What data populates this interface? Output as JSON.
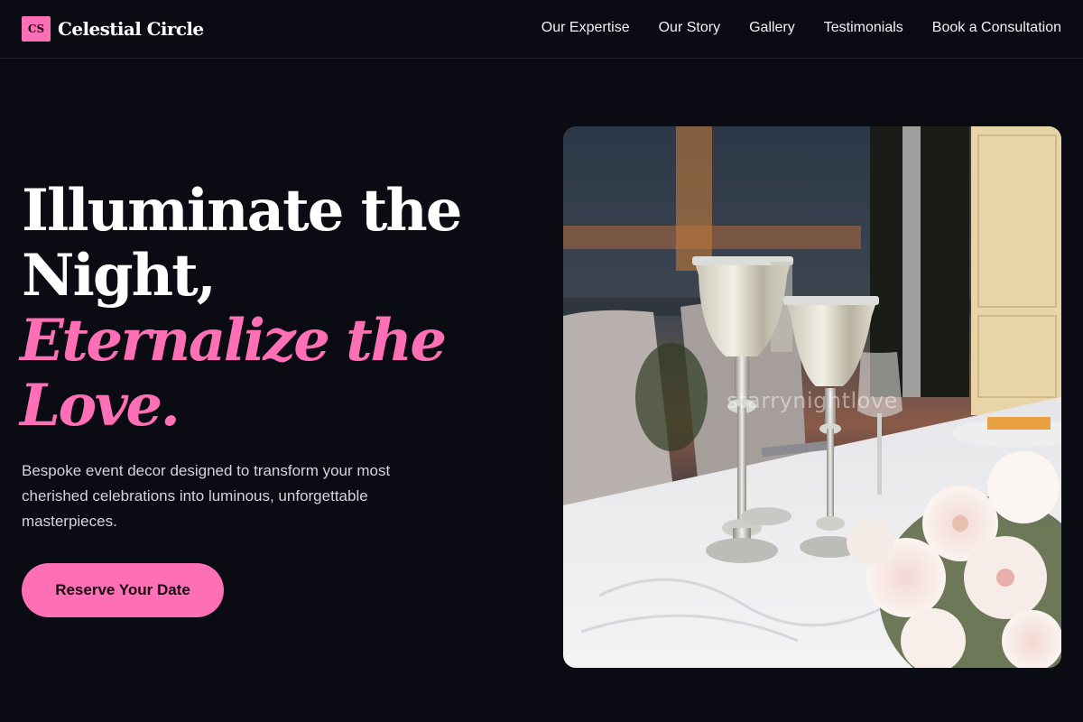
{
  "brand": {
    "logo_mark": "CS",
    "name": "Celestial Circle"
  },
  "nav": {
    "items": [
      {
        "label": "Our Expertise"
      },
      {
        "label": "Our Story"
      },
      {
        "label": "Gallery"
      },
      {
        "label": "Testimonials"
      },
      {
        "label": "Book a Consultation"
      }
    ]
  },
  "hero": {
    "title_line1": "Illuminate the",
    "title_line2": "Night,",
    "accent_line1": "Eternalize the",
    "accent_line2": "Love.",
    "subtitle": "Bespoke event decor designed to transform your most cherished celebrations into luminous, unforgettable masterpieces.",
    "cta_label": "Reserve Your Date",
    "image_watermark": "starrynightlove"
  },
  "colors": {
    "background": "#0b0b14",
    "accent": "#ff6fb5",
    "text": "#ffffff",
    "muted_text": "#d4d4dc"
  },
  "icons": {
    "logo": "cs-monogram-icon"
  }
}
